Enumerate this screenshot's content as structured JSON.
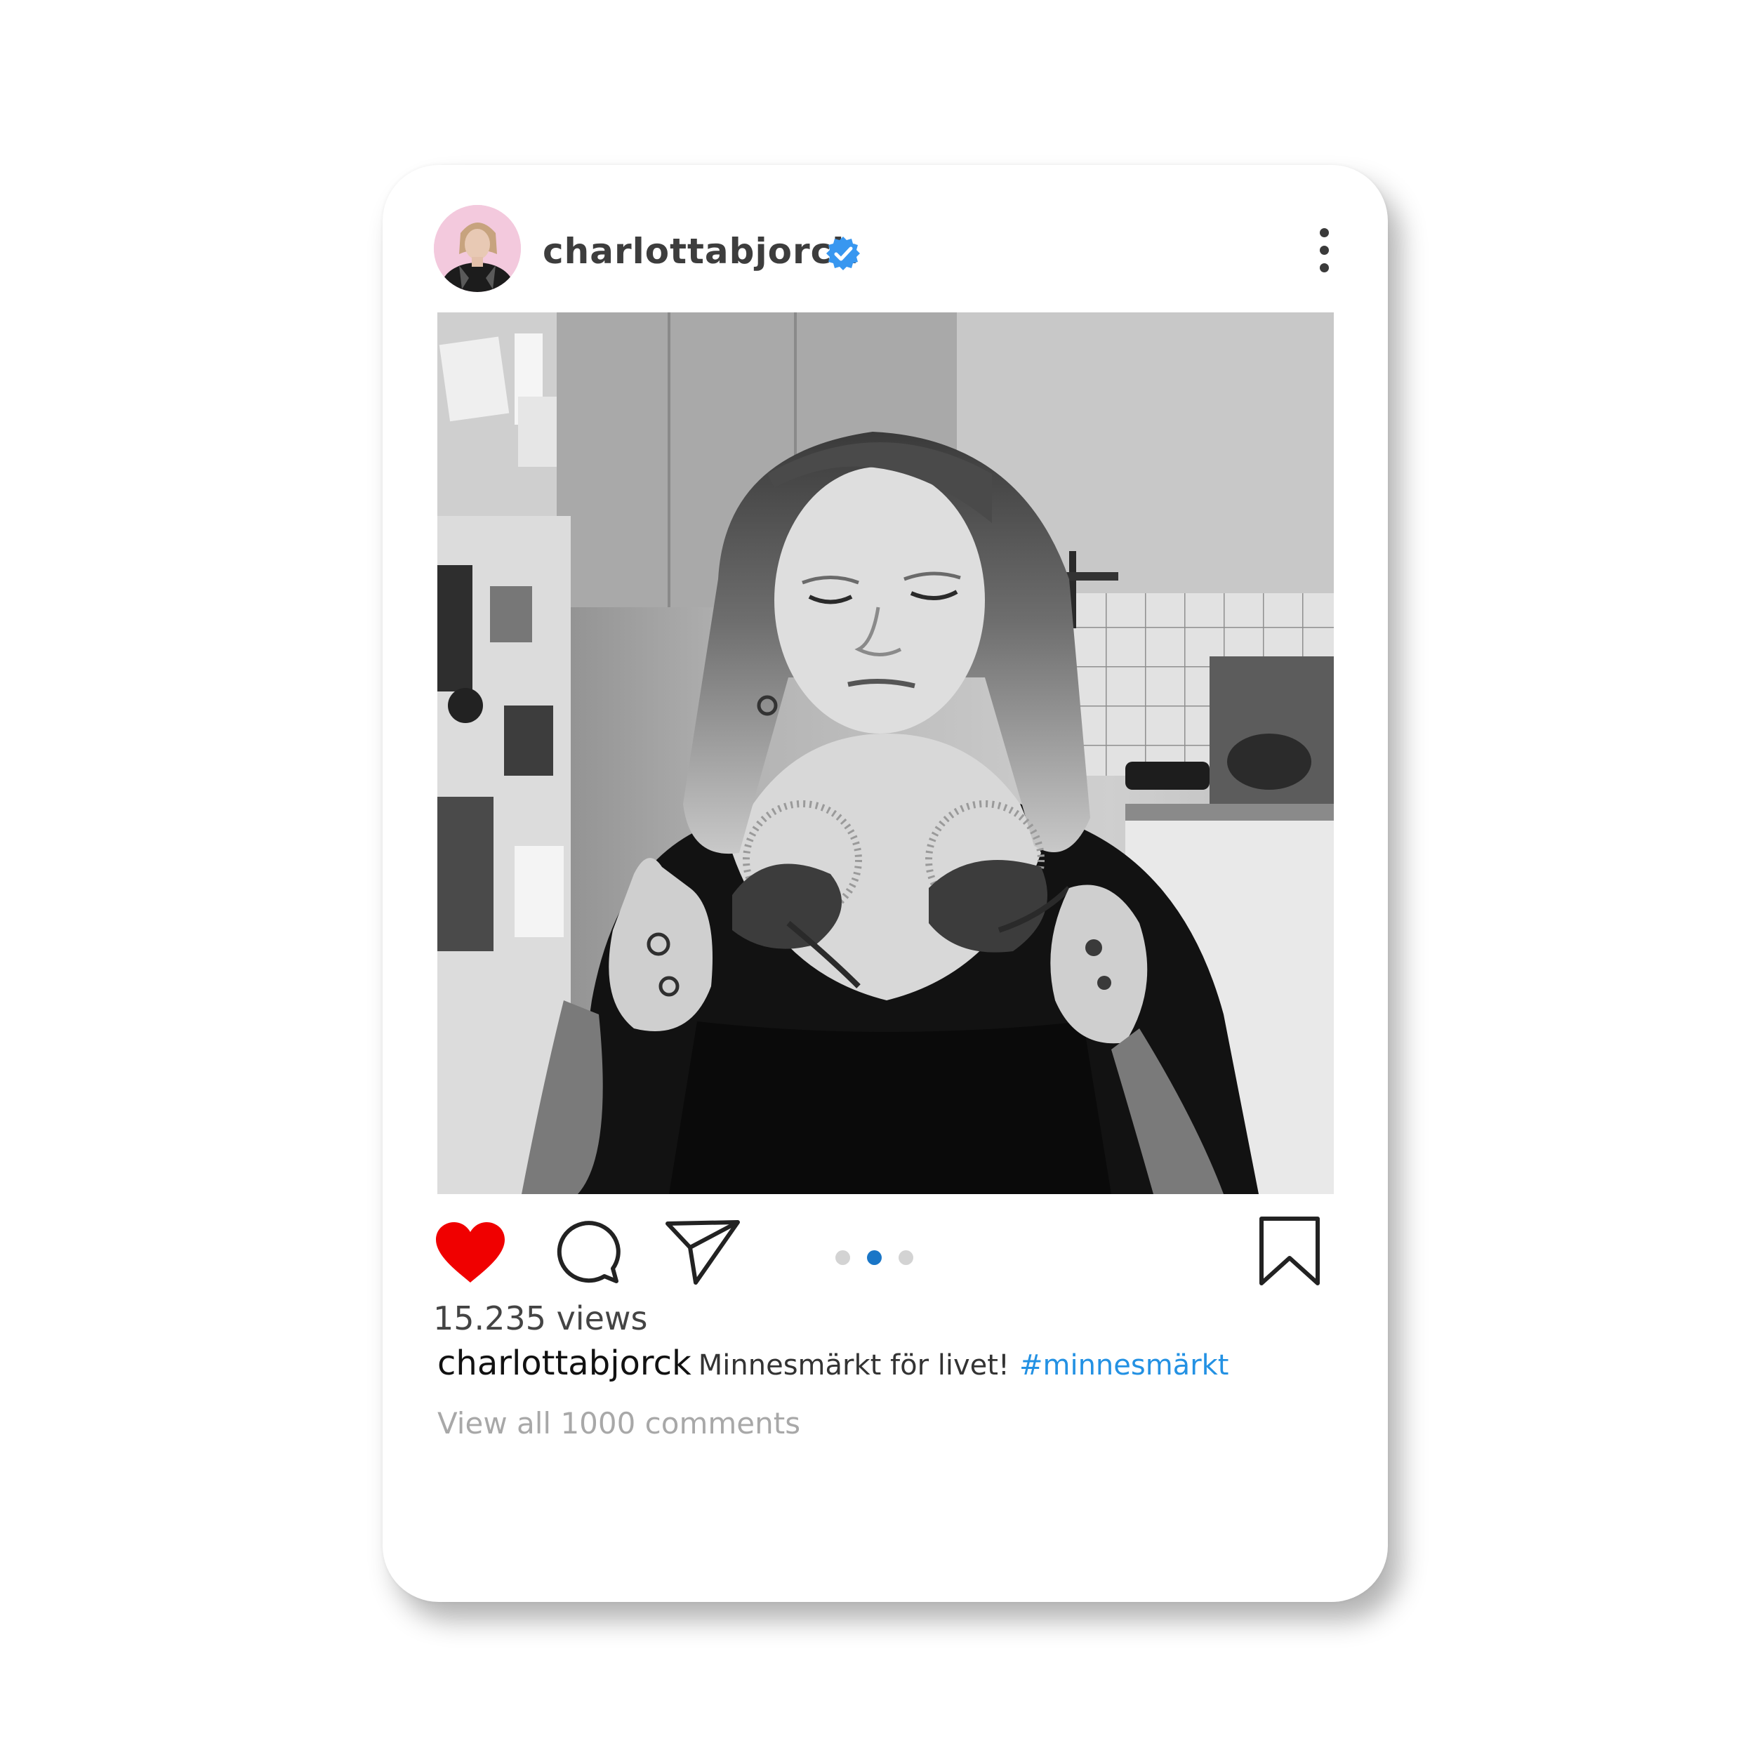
{
  "post": {
    "username": "charlottabjorck",
    "verified": true,
    "views": "15.235 views",
    "caption": {
      "username": "charlottabjorck",
      "text": "Minnesmärkt för livet!",
      "hashtag": "#minnesmärkt"
    },
    "comments_link": "View all 1000 comments",
    "carousel": {
      "total": 3,
      "active_index": 1
    },
    "liked": true
  },
  "icons": {
    "more": "more-vertical-icon",
    "like": "heart-icon",
    "comment": "comment-bubble-icon",
    "share": "paper-plane-icon",
    "save": "bookmark-icon",
    "verified": "verified-badge-icon"
  },
  "colors": {
    "like_red": "#f00000",
    "verified_blue": "#3897f0",
    "hashtag_blue": "#2391e3",
    "carousel_active": "#1a76c7",
    "muted_gray": "#a8a8a8"
  }
}
